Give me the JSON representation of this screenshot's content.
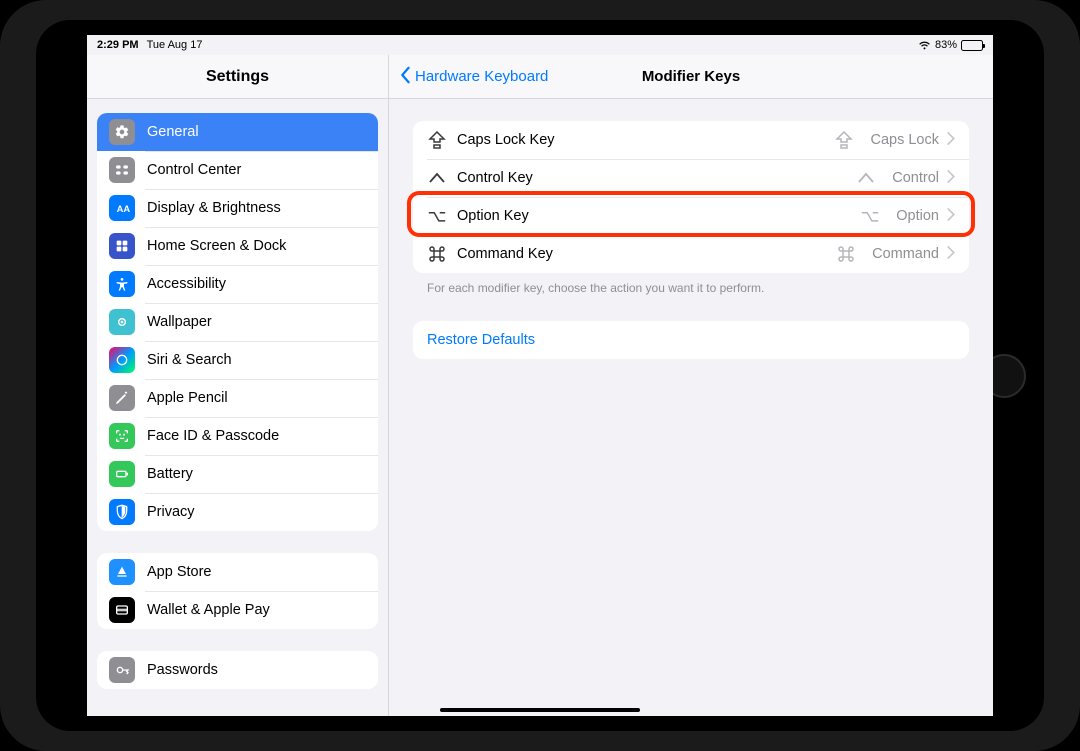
{
  "status": {
    "time": "2:29 PM",
    "date": "Tue Aug 17",
    "battery_pct": "83%"
  },
  "sidebar": {
    "title": "Settings",
    "groups": {
      "g1": {
        "general": "General",
        "control_center": "Control Center",
        "display": "Display & Brightness",
        "home": "Home Screen & Dock",
        "accessibility": "Accessibility",
        "wallpaper": "Wallpaper",
        "siri": "Siri & Search",
        "pencil": "Apple Pencil",
        "faceid": "Face ID & Passcode",
        "battery": "Battery",
        "privacy": "Privacy"
      },
      "g2": {
        "appstore": "App Store",
        "wallet": "Wallet & Apple Pay"
      },
      "g3": {
        "passwords": "Passwords"
      }
    }
  },
  "detail": {
    "back": "Hardware Keyboard",
    "title": "Modifier Keys",
    "rows": {
      "capslock": {
        "label": "Caps Lock Key",
        "value": "Caps Lock"
      },
      "control": {
        "label": "Control Key",
        "value": "Control"
      },
      "option": {
        "label": "Option Key",
        "value": "Option"
      },
      "command": {
        "label": "Command Key",
        "value": "Command"
      }
    },
    "footer": "For each modifier key, choose the action you want it to perform.",
    "restore": "Restore Defaults"
  }
}
